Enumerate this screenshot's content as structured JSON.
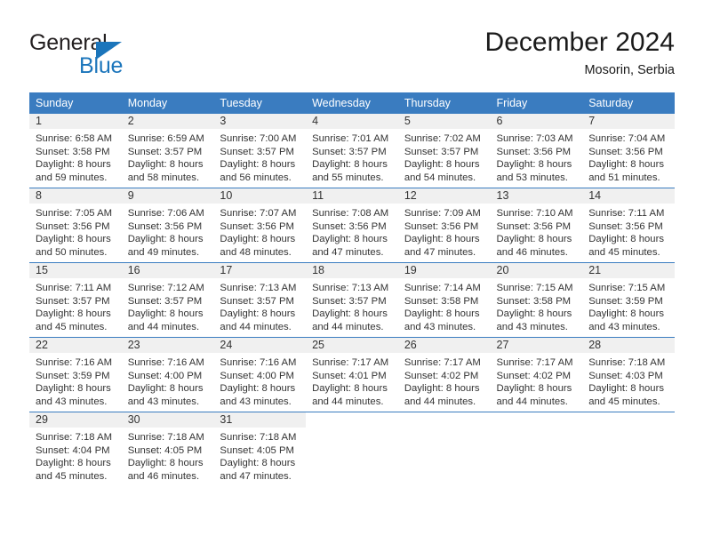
{
  "brand": {
    "name_part1": "General",
    "name_part2": "Blue",
    "triangle_color": "#1b75bb"
  },
  "header": {
    "title": "December 2024",
    "subtitle": "Mosorin, Serbia"
  },
  "theme": {
    "header_blue": "#3a7cc0",
    "daynum_band": "#f0f0f0",
    "text": "#333333"
  },
  "weekday_headers": [
    "Sunday",
    "Monday",
    "Tuesday",
    "Wednesday",
    "Thursday",
    "Friday",
    "Saturday"
  ],
  "weeks": [
    [
      {
        "day": "1",
        "sunrise": "Sunrise: 6:58 AM",
        "sunset": "Sunset: 3:58 PM",
        "daylight1": "Daylight: 8 hours",
        "daylight2": "and 59 minutes."
      },
      {
        "day": "2",
        "sunrise": "Sunrise: 6:59 AM",
        "sunset": "Sunset: 3:57 PM",
        "daylight1": "Daylight: 8 hours",
        "daylight2": "and 58 minutes."
      },
      {
        "day": "3",
        "sunrise": "Sunrise: 7:00 AM",
        "sunset": "Sunset: 3:57 PM",
        "daylight1": "Daylight: 8 hours",
        "daylight2": "and 56 minutes."
      },
      {
        "day": "4",
        "sunrise": "Sunrise: 7:01 AM",
        "sunset": "Sunset: 3:57 PM",
        "daylight1": "Daylight: 8 hours",
        "daylight2": "and 55 minutes."
      },
      {
        "day": "5",
        "sunrise": "Sunrise: 7:02 AM",
        "sunset": "Sunset: 3:57 PM",
        "daylight1": "Daylight: 8 hours",
        "daylight2": "and 54 minutes."
      },
      {
        "day": "6",
        "sunrise": "Sunrise: 7:03 AM",
        "sunset": "Sunset: 3:56 PM",
        "daylight1": "Daylight: 8 hours",
        "daylight2": "and 53 minutes."
      },
      {
        "day": "7",
        "sunrise": "Sunrise: 7:04 AM",
        "sunset": "Sunset: 3:56 PM",
        "daylight1": "Daylight: 8 hours",
        "daylight2": "and 51 minutes."
      }
    ],
    [
      {
        "day": "8",
        "sunrise": "Sunrise: 7:05 AM",
        "sunset": "Sunset: 3:56 PM",
        "daylight1": "Daylight: 8 hours",
        "daylight2": "and 50 minutes."
      },
      {
        "day": "9",
        "sunrise": "Sunrise: 7:06 AM",
        "sunset": "Sunset: 3:56 PM",
        "daylight1": "Daylight: 8 hours",
        "daylight2": "and 49 minutes."
      },
      {
        "day": "10",
        "sunrise": "Sunrise: 7:07 AM",
        "sunset": "Sunset: 3:56 PM",
        "daylight1": "Daylight: 8 hours",
        "daylight2": "and 48 minutes."
      },
      {
        "day": "11",
        "sunrise": "Sunrise: 7:08 AM",
        "sunset": "Sunset: 3:56 PM",
        "daylight1": "Daylight: 8 hours",
        "daylight2": "and 47 minutes."
      },
      {
        "day": "12",
        "sunrise": "Sunrise: 7:09 AM",
        "sunset": "Sunset: 3:56 PM",
        "daylight1": "Daylight: 8 hours",
        "daylight2": "and 47 minutes."
      },
      {
        "day": "13",
        "sunrise": "Sunrise: 7:10 AM",
        "sunset": "Sunset: 3:56 PM",
        "daylight1": "Daylight: 8 hours",
        "daylight2": "and 46 minutes."
      },
      {
        "day": "14",
        "sunrise": "Sunrise: 7:11 AM",
        "sunset": "Sunset: 3:56 PM",
        "daylight1": "Daylight: 8 hours",
        "daylight2": "and 45 minutes."
      }
    ],
    [
      {
        "day": "15",
        "sunrise": "Sunrise: 7:11 AM",
        "sunset": "Sunset: 3:57 PM",
        "daylight1": "Daylight: 8 hours",
        "daylight2": "and 45 minutes."
      },
      {
        "day": "16",
        "sunrise": "Sunrise: 7:12 AM",
        "sunset": "Sunset: 3:57 PM",
        "daylight1": "Daylight: 8 hours",
        "daylight2": "and 44 minutes."
      },
      {
        "day": "17",
        "sunrise": "Sunrise: 7:13 AM",
        "sunset": "Sunset: 3:57 PM",
        "daylight1": "Daylight: 8 hours",
        "daylight2": "and 44 minutes."
      },
      {
        "day": "18",
        "sunrise": "Sunrise: 7:13 AM",
        "sunset": "Sunset: 3:57 PM",
        "daylight1": "Daylight: 8 hours",
        "daylight2": "and 44 minutes."
      },
      {
        "day": "19",
        "sunrise": "Sunrise: 7:14 AM",
        "sunset": "Sunset: 3:58 PM",
        "daylight1": "Daylight: 8 hours",
        "daylight2": "and 43 minutes."
      },
      {
        "day": "20",
        "sunrise": "Sunrise: 7:15 AM",
        "sunset": "Sunset: 3:58 PM",
        "daylight1": "Daylight: 8 hours",
        "daylight2": "and 43 minutes."
      },
      {
        "day": "21",
        "sunrise": "Sunrise: 7:15 AM",
        "sunset": "Sunset: 3:59 PM",
        "daylight1": "Daylight: 8 hours",
        "daylight2": "and 43 minutes."
      }
    ],
    [
      {
        "day": "22",
        "sunrise": "Sunrise: 7:16 AM",
        "sunset": "Sunset: 3:59 PM",
        "daylight1": "Daylight: 8 hours",
        "daylight2": "and 43 minutes."
      },
      {
        "day": "23",
        "sunrise": "Sunrise: 7:16 AM",
        "sunset": "Sunset: 4:00 PM",
        "daylight1": "Daylight: 8 hours",
        "daylight2": "and 43 minutes."
      },
      {
        "day": "24",
        "sunrise": "Sunrise: 7:16 AM",
        "sunset": "Sunset: 4:00 PM",
        "daylight1": "Daylight: 8 hours",
        "daylight2": "and 43 minutes."
      },
      {
        "day": "25",
        "sunrise": "Sunrise: 7:17 AM",
        "sunset": "Sunset: 4:01 PM",
        "daylight1": "Daylight: 8 hours",
        "daylight2": "and 44 minutes."
      },
      {
        "day": "26",
        "sunrise": "Sunrise: 7:17 AM",
        "sunset": "Sunset: 4:02 PM",
        "daylight1": "Daylight: 8 hours",
        "daylight2": "and 44 minutes."
      },
      {
        "day": "27",
        "sunrise": "Sunrise: 7:17 AM",
        "sunset": "Sunset: 4:02 PM",
        "daylight1": "Daylight: 8 hours",
        "daylight2": "and 44 minutes."
      },
      {
        "day": "28",
        "sunrise": "Sunrise: 7:18 AM",
        "sunset": "Sunset: 4:03 PM",
        "daylight1": "Daylight: 8 hours",
        "daylight2": "and 45 minutes."
      }
    ],
    [
      {
        "day": "29",
        "sunrise": "Sunrise: 7:18 AM",
        "sunset": "Sunset: 4:04 PM",
        "daylight1": "Daylight: 8 hours",
        "daylight2": "and 45 minutes."
      },
      {
        "day": "30",
        "sunrise": "Sunrise: 7:18 AM",
        "sunset": "Sunset: 4:05 PM",
        "daylight1": "Daylight: 8 hours",
        "daylight2": "and 46 minutes."
      },
      {
        "day": "31",
        "sunrise": "Sunrise: 7:18 AM",
        "sunset": "Sunset: 4:05 PM",
        "daylight1": "Daylight: 8 hours",
        "daylight2": "and 47 minutes."
      },
      {
        "day": "",
        "sunrise": "",
        "sunset": "",
        "daylight1": "",
        "daylight2": ""
      },
      {
        "day": "",
        "sunrise": "",
        "sunset": "",
        "daylight1": "",
        "daylight2": ""
      },
      {
        "day": "",
        "sunrise": "",
        "sunset": "",
        "daylight1": "",
        "daylight2": ""
      },
      {
        "day": "",
        "sunrise": "",
        "sunset": "",
        "daylight1": "",
        "daylight2": ""
      }
    ]
  ]
}
